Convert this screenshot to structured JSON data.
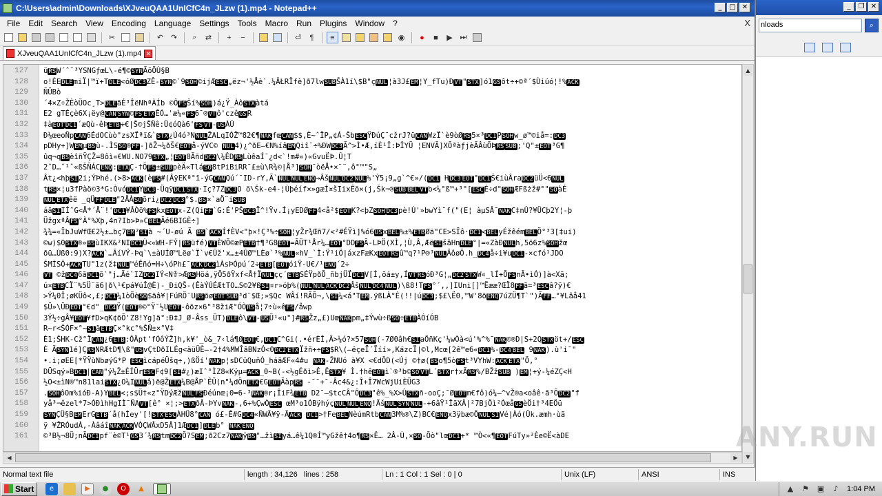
{
  "window": {
    "title": "C:\\Users\\admin\\Downloads\\XJveuQAA1UnICfC4n_JLzw (1).mp4 - Notepad++"
  },
  "background_window": {
    "address_text": "nloads"
  },
  "menu": [
    "File",
    "Edit",
    "Search",
    "View",
    "Encoding",
    "Language",
    "Settings",
    "Tools",
    "Macro",
    "Run",
    "Plugins",
    "Window",
    "?"
  ],
  "menu_close": "X",
  "tab": {
    "label": "XJveuQAA1UnICfC4n_JLzw (1).mp4"
  },
  "editor": {
    "lines": [
      {
        "n": "127",
        "t": "üRSW´ˆ¯³YSNGƒœL\\-é¶©SYNÃõÕÙ§B"
      },
      {
        "n": "128",
        "t": "o!ÈEDLEmiÏ|™ï+TDLE<óØDC3ZÊ-SYN©`9SOH©ijÆESC„ëz¬'½Åè`.¼ÂŁRÎfè]ð7lwSUBŠÀ1í\\$B\"çNUL¦à3J£EM¦Y_fTu)ÐVT\"STX]ó1GSôt÷+©ª´$Ùiúó¦!%ACK"
      },
      {
        "n": "129",
        "t": "ÑÜBò"
      },
      {
        "n": "130",
        "t": "´4×Z÷ŽÈòÜOc¸T>DLEãÉ³ÎëNhªÀÍb ©ÔFSŠí%SOH)á¿Ÿ_ÀôSTXàtá"
      },
      {
        "n": "131",
        "t": "E2 gTÉçè6X¡ëy@CANSYN©FSETXÊÓ…'æ¼«FS6¯®VTô'czêGSR"
      },
      {
        "n": "132",
        "t": "‡àEOTDC1´æQù-êÞETB÷€|Š©jŠÑê:Ü¢óQà6'FSVT-USÀÛ"
      },
      {
        "n": "133",
        "t": "Ð¼œeoÑpCAN6ÉdOCùò\"zsXÏªï&`STX¿Ú4ó³NNULŽALqIÓŽ™82€¶NAKfœCAN$$,È~ˆÎP„¢Á-ŠbESCŸÐúÇ¨cžrJ?üCANWzÏ`è9òØRS5×³DC1PSOHw_ø™©iå=:DC3"
      },
      {
        "n": "134",
        "t": "pDHy+]WEMµBSù-.ÌSSO®FF-]ðŽ¬¼ðŠ€EOTå-ýVC© NUL4)¿^ðE—€N%íâEMQiî¨÷%ÐWDC3Ã^>Ì•Æ,ïÈ¹Î:ÞÎYÜ ¦ENVÃ]XÕªàƒjèÄÂùÖÞRSSUB;'Q\"±EOT³G¶"
      },
      {
        "n": "135",
        "t": "ûq¬qBSèîñŸÇŽ=8ôì«€WU.NO79STX„¦EOT8ÃñdDC2\\¼ÊDRSLùêaÍ¯¿d<`!m#«)«GvuËÞ.Û¦T"
      },
      {
        "n": "136",
        "t": "2ˆD…ˆ¹ˆ«ßŠÑÁCENQ:ETXÇ-†ÕFS±SUBpèÄ«TláSO8tPiBiRR¯£±ù\\R¾©|Å³]SOH¨òëÅ•×¨¨,ô°™\"S„"
      },
      {
        "n": "137",
        "t": "Ât¿<hþSI2i;ÝÞhé.(>8>ACK(èFS#(ÂÿEKª°ï-ýGCANQú´¯ID-rY,Ã`NULNULENQ→ÂšNULDC2NUL%'Ý5¡9„g`^€»/(DC1 HDC3EOT°DC1Š€iùÂraDC2üÜ<6NUL"
      },
      {
        "n": "138",
        "t": "tRS×¦u3fPàö©3*G:ÒvóDC1YDC3-ÜqÿDC1STX·Iç?7ZDC3O ö\\Šk-e4-¦Ùþéíf×»gæÍ¤šIixÊö×(j,Šk¬®SUBBELVTb<¼°ß™+³\"[ESCÈ÷d\"SOHÆFßżž#°\"SOàÉ"
      },
      {
        "n": "139",
        "t": "NULETXêë _qÜFFDLE\"2ÅÀSOõri¿DC2DC3°$.BS×`aÖ¨iSUB"
      },
      {
        "n": "140",
        "t": "áâSIIÌˆG<Å*´Å¨!'DC1¥ÂÒõ%FSkxEOTx-Z(QiFF`G:É'PŠDC3Ï^!Ÿv.Í¡yEDØFF4<å²$EOTK?<þZSOHDC3pè!Ú'»bwYì¨f(\"(E¦ àµSÂ¯NAKC‡nÛ?¥ÜCþ2Y¦-þ"
      },
      {
        "n": "141",
        "t": "ÜžgxªÂFS°À°%Xþ,4n?Ib>Þ»CBELÃé6BIGÈ÷]"
      },
      {
        "n": "142",
        "t": "¾¾=«ÏbJuWfŒ€2½±…bç7EM²SIà ~´U-øú Ä  BS`ACKÍfÈV<\"þ×!Ç³%÷SOH¦yŽr¾Œñ7/<²#ÉŸì]%ó6USxBEL%±%ETBØä\"CE>SÏô·DC1<BELyÉžêémBELÖ°³3[‡ui)"
      },
      {
        "n": "143",
        "t": "©w)$0STX®»BSùIKX&²NIDC1Ù<«WH-FÝ|RSüfé)VTÈWÕ©æPETB†¶³G8EOT=ÃÜT¹År¼…EOT°DDFSÃ-LÞÖ(XÌ,¦Ù,Â,ÆëSIšâHnDLE°|=«ZàÐNULh,5ö6z%SOHžœ"
      },
      {
        "n": "144",
        "t": "ðü…Ùß0:9)X?ACK`…ÃíVŸ-Þq`\\±àUÍØ™Lëø`Ï`v€Üž'x…±4ÛØ™LÈø`³%NUL«hV_`Ì:Ÿ¹iÖ|áxzFæKxEOTRSû™q?¹P®³NULÄôøÕ.h_DC4å÷i¥uDC1-×cfó¹JDO"
      },
      {
        "n": "145",
        "t": "ŠMÌSÔ+ACKTU\"1z(ž‡NUL™éÊñó=H÷\\óPh£¯ACKDC2ìÀsÞÓpú´2÷ETB[EOTóiŸ-U€/¹ENQ´2÷"
      },
      {
        "n": "146",
        "t": "VT ©žDC46ãDC1õ`\"j…Äé`IZDC2IÝ<Nꎳ>ÆRSHöá,ÿÕ5ðŸxf<Å†ÏNULçç´ETBSÉŸpðÕ_ñbjÜÏDC1V[Í,õá±y,ÍVTRSóÐ³G¦„DC2STXW«_lÍ+ÕFSnÃ•ìÓ)]à<Xä;"
      },
      {
        "n": "147",
        "t": "ú×ETBCÏ¨%5Ü¨ã6|ð\\¹€pá¥úÎ@È)-_ÐiQŠ-(ÊàÝÚÉÆtTO…S©2¥ßSI¤r»óþ%(NULNULACKDC2ÂšNULDC4NUL)\\ß8!TFS°´,,]IUni[]™Ëææ?ŒÏ8FFã=³ESCâ?ÿ)€"
      },
      {
        "n": "148",
        "t": ">Ý¼0Î;øKÜô<,£;DC1¼1òÖèSO$ãâ¥|FúRÖ¨URSõøEOTSUB³d¨$Œ;»$Qc WÂí!RÃÕ¬,\\SI¼<á\"TEM.ÿßLÀ°È(!!|úDC3;$£\\Ë0,™W'8õENQ7úZÜ¶T`\")ÃFF…°¥Lâå41"
      },
      {
        "n": "149",
        "t": "$Ü»\\ÜÐEOT°€d\"_DC4Ÿ(EOT®©°Ÿ¯½UEOT-ôõz×6\"³8žiÆ°ÓÒRSå¦7÷ù«êFS/åwp"
      },
      {
        "n": "150",
        "t": "3Ý½÷gÂ¥EOT¥fD>qK¢õÕ'Z8!Yg]ä°:Ð‡J_Ø-Âss_ÜT)DLEô\\VT-USÜ¹«u\"]#RSŽz„£)UœNAKpm„‡Ýwù÷ßSO÷ETBÀÓíÓB"
      },
      {
        "n": "151",
        "t": "R~r<ŠÓF×°~SIäETBÇ×°kc°%ŠÑ±×°V‡"
      },
      {
        "n": "152",
        "t": "È1;ŠHK-Cž°ÏCAN¿6ETB:ÔÄpt'fÓôÝŽ]h,k¥'_ò&_7‹lá¶ØEOT€,DC1C^Gi(.•érÈÎ,Ã>¼ó?×57SOH(-7Ø0âh€SIaÖñKç'¼wÒà<ú'%^%¯NAK©®D|S+2QSTXöt+/ESC"
      },
      {
        "n": "153",
        "t": "È ÄSYN1é]ÇRSNRÆtD¶\\ß\"USvÇtDðILÉg<àüÜÈ—-2†4%MWÎâBNzÓ<0DC2ETXÏžñ+÷FS$R\\(—ëçeÏ´Ïíí»,KázcÏ|©l,Mcœ[2ê™e6«DC1%-DC4BEL 9NAK).ù'i¯\""
      },
      {
        "n": "154",
        "t": "  •.i;øEE[*ŸŸùNbøýG*P ESCìcápéÜšq÷,)ßÖí'NAKp¦sDCüQuñÒ_háãÆF«4#u  NAK-ŽNUó à¥X  <€dÖD(<Új  ©†ø(BSo¶5òFSt³VYhW:ACKETX\"Ö,°"
      },
      {
        "n": "155",
        "t": "DÜSqý»BDC1|CAN\"ý¼Ž±ÈÍÜrESCF¢9[SI#¿)æIˆ°ÌZ8«Kýµ=ACK_0~B(-<½gÉðì>Ê,ÊSTX¥ Ì.†hêEOTì`®³b©SOVTL´STXr†xÃRS%/BŽžSUB )EM¦+ý-¼éZÇ<H"
      },
      {
        "n": "156",
        "t": "½O<±ìN®™n81laiSTX¿O¼INULâ)ë@ŽETX¼B@ÅP`ÊÜ(n\"¼dÖnETX€GEOTÃàpRS -¯¯+¯-Âc4&¿:Î+Î7WcWjUiÈÜG3"
      },
      {
        "n": "157",
        "t": ".SOHôOm%ióÐ-A)YBEL<;s$Ü†«z\"ŸDýÆžNULFSÐéúnœ¡0=6-³NAK®r¡ÎiF¾ETB D2¯—$tcCÂ\"ÔDC3\"ê%_%X>ÛSTXñ-ooÇ;¯ØEOTm€fô)ó¼—^vŽ®a<oâê·ã³ÕDC2\"f"
      },
      {
        "n": "158",
        "t": "yå³¬êzel*7>ÓÐìhHgIÌ¯ÑAVT[ê° ×¦;>ETXðÂ-ÞYvNAK-,6÷%ÇwÒESC œM³o1ÓBÿhýçNULNULENQ!ÄšNULSYNNUL-+6âŸ¹ÎãXÂ|²7BjÖì²ÓœåGSèÖi†³4EÖü"
      },
      {
        "n": "159",
        "t": "SYNÇÜ§BEMErGETB´å(hÌey'[!STXESCÀHÜ8°CAN  ó£-Ê#GDC4«ÑWÃ¥ÿ-ÃACK DC1>†FeBELNèúmRtbCAN3M%®\\Z)BC€ENQx3ÿbæ©ÕNULSIVé|Àó(Ük.æmh·ùã"
      },
      {
        "n": "160",
        "t": "ÿ ¥ŽRÓudÀ,-ÀâáîNAKACKVÒÇWÂxD5Â]1ÆDC1]DLEb°  NAKENQ"
      },
      {
        "n": "161",
        "t": "©³B½¬8Ü;nÃDC1pf¨è©T¹GS3´¾RStmDC2Õ?SEM;ð2Cz7NAKÿBS\"…žìSIyá…ê¼1Q®Í™yGžê†4o¶RS×Ê… 2Â-Ù,×SO-Õò\"lœDC1+*  ™Ò<«¶EOTFúTy»²Èe©Ë<àDE"
      }
    ]
  },
  "status": {
    "file_type": "Normal text file",
    "length": "length : 34,126",
    "lines": "lines : 258",
    "position": "Ln : 1   Col : 1   Sel : 0 | 0",
    "eol": "Unix (LF)",
    "encoding": "ANSI",
    "mode": "INS"
  },
  "taskbar": {
    "start_label": "Start",
    "clock": "1:04 PM"
  },
  "watermark": "ANY.RUN",
  "colors": {
    "titlebar": "#2a63c9",
    "desktop": "#3a6ea5",
    "control_char_bg": "#000000"
  }
}
